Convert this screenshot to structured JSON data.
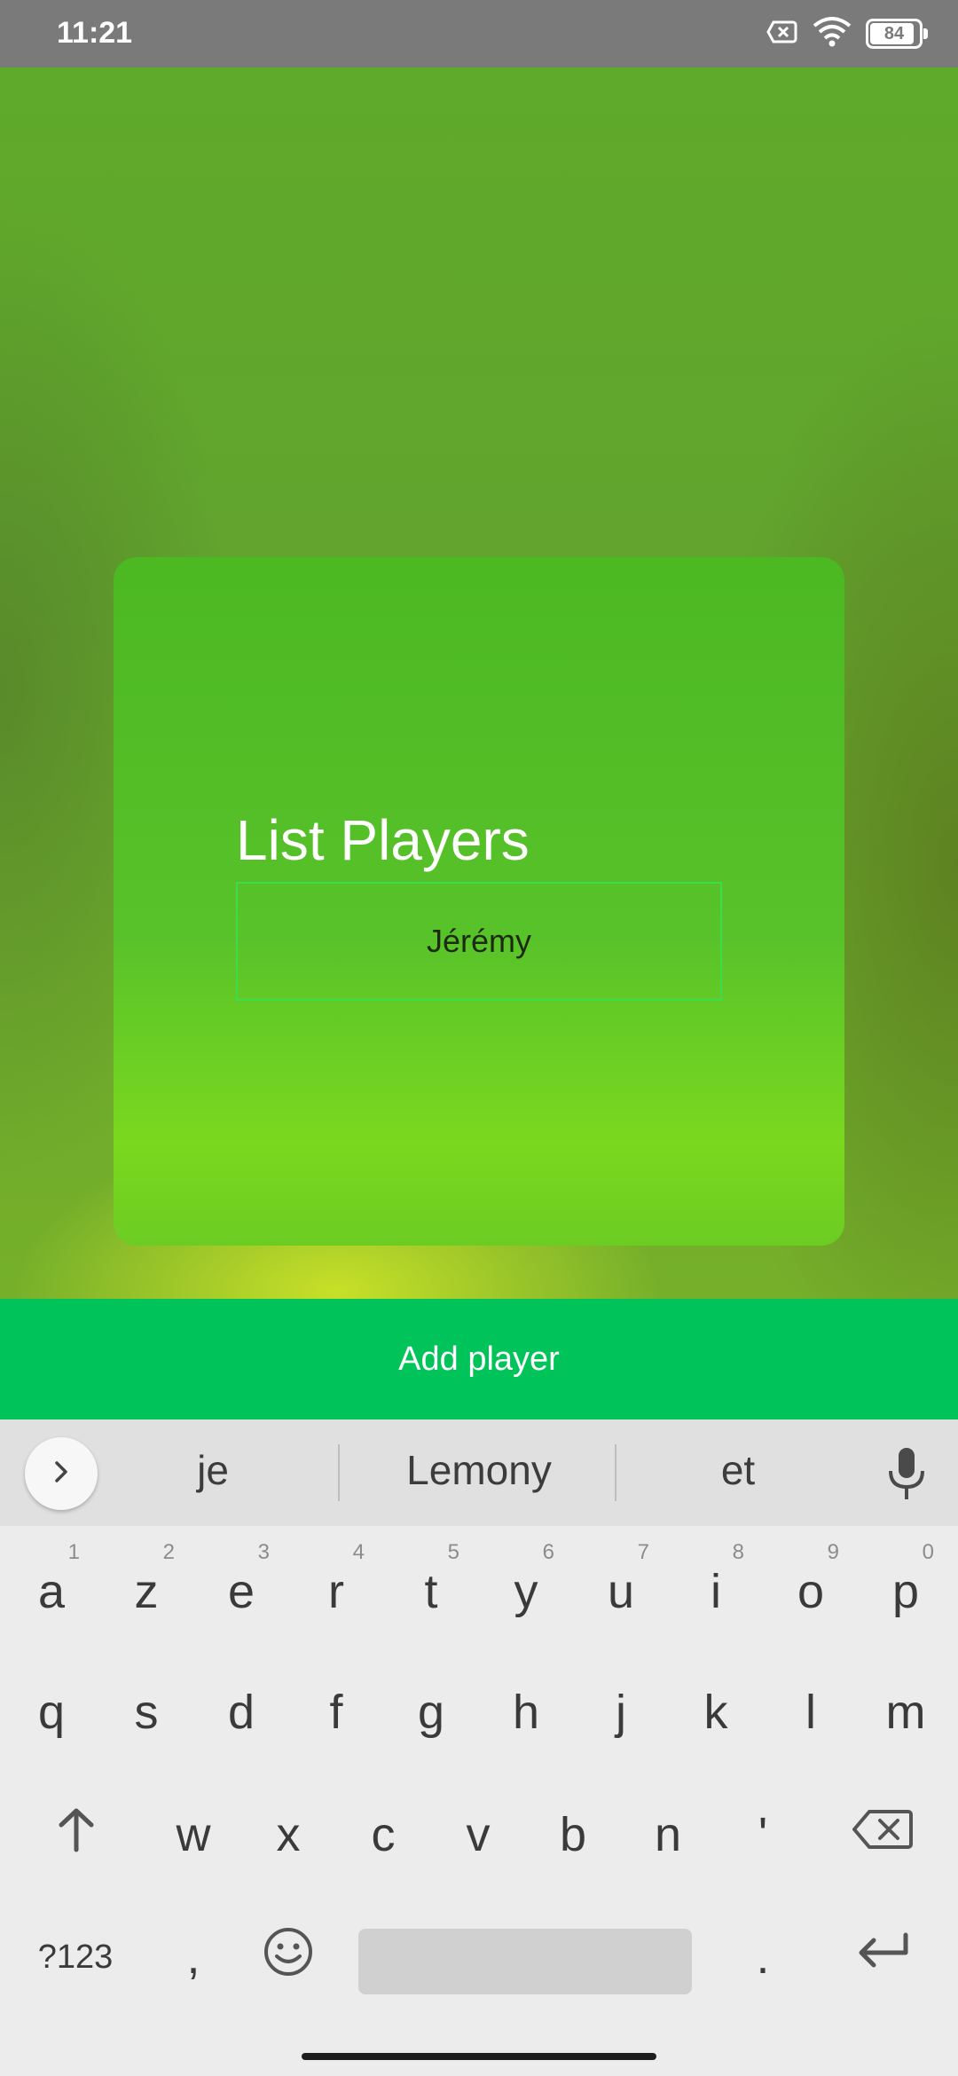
{
  "status_bar": {
    "time": "11:21",
    "battery_level": "84",
    "icons": [
      "no-sim-icon",
      "wifi-icon",
      "battery-icon"
    ]
  },
  "screen": {
    "title": "List Players",
    "players": [
      "Jérémy"
    ],
    "add_button_label": "Add player"
  },
  "keyboard": {
    "suggestions": [
      "je",
      "Lemony",
      "et"
    ],
    "row1": [
      {
        "key": "a",
        "num": "1"
      },
      {
        "key": "z",
        "num": "2"
      },
      {
        "key": "e",
        "num": "3"
      },
      {
        "key": "r",
        "num": "4"
      },
      {
        "key": "t",
        "num": "5"
      },
      {
        "key": "y",
        "num": "6"
      },
      {
        "key": "u",
        "num": "7"
      },
      {
        "key": "i",
        "num": "8"
      },
      {
        "key": "o",
        "num": "9"
      },
      {
        "key": "p",
        "num": "0"
      }
    ],
    "row2": [
      "q",
      "s",
      "d",
      "f",
      "g",
      "h",
      "j",
      "k",
      "l",
      "m"
    ],
    "row3": [
      "w",
      "x",
      "c",
      "v",
      "b",
      "n",
      "'"
    ],
    "symbols_label": "?123",
    "comma": ",",
    "period": "."
  },
  "colors": {
    "accent_green": "#00c45a",
    "status_bar": "#7a7a7a"
  }
}
